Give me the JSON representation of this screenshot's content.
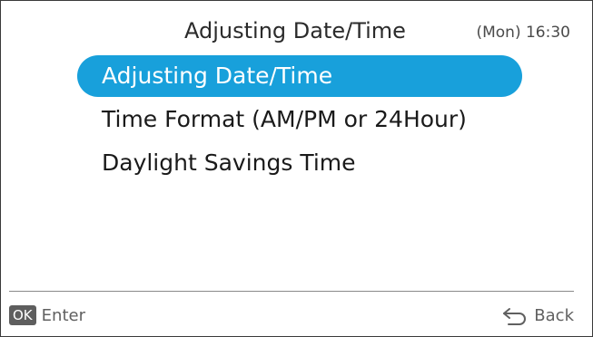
{
  "header": {
    "title": "Adjusting Date/Time",
    "clock": "(Mon) 16:30"
  },
  "menu": {
    "items": [
      {
        "label": "Adjusting Date/Time",
        "selected": true
      },
      {
        "label": "Time Format (AM/PM or 24Hour)",
        "selected": false
      },
      {
        "label": "Daylight Savings Time",
        "selected": false
      }
    ]
  },
  "footer": {
    "ok_icon_text": "OK",
    "enter_label": "Enter",
    "back_label": "Back",
    "back_icon": "return-arrow-icon"
  },
  "colors": {
    "accent": "#18a0db",
    "border": "#3a3a3a",
    "icon_bg": "#5e5e5e"
  }
}
